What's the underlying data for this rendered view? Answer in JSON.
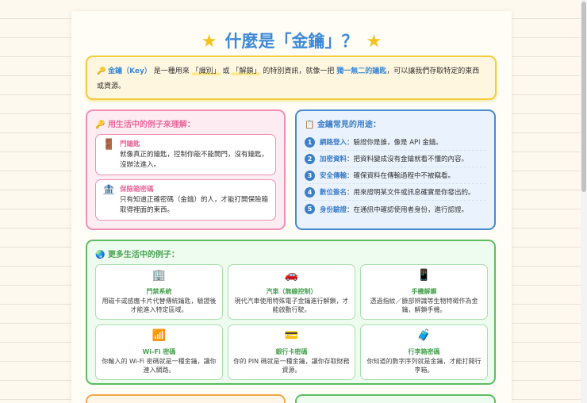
{
  "title": "什麼是「金鑰」？",
  "definition": {
    "term": "金鑰（Key）",
    "p1": "是一種用來",
    "hl1": "「識別」",
    "p2": "或",
    "hl2": "「解鎖」",
    "p3": "的特別資訊，就像一把",
    "em": "獨一無二的鑰匙",
    "p4": "，可以讓我們存取特定的東西或資源。"
  },
  "examples": {
    "heading": "用生活中的例子來理解：",
    "items": [
      {
        "icon": "door-icon",
        "glyph": "🚪",
        "title": "門鑰匙",
        "text": "就像真正的鑰匙，控制你能不能開門，沒有鑰匙，沒辦法進入。"
      },
      {
        "icon": "bank-icon",
        "glyph": "🏦",
        "title": "保險箱密碼",
        "text": "只有知道正確密碼（金鑰）的人，才能打開保險箱取得裡面的東西。"
      }
    ]
  },
  "uses": {
    "heading": "金鑰常見的用途：",
    "items": [
      {
        "n": "1",
        "k": "網路登入",
        "v": "：驗證你是誰，像是 API 金鑰。"
      },
      {
        "n": "2",
        "k": "加密資料",
        "v": "：把資料變成沒有金鑰就看不懂的內容。"
      },
      {
        "n": "3",
        "k": "安全傳輸",
        "v": "：確保資料在傳輸過程中不被竊看。"
      },
      {
        "n": "4",
        "k": "數位簽名",
        "v": "：用來證明某文件或訊息確實是你發出的。"
      },
      {
        "n": "5",
        "k": "身份驗證",
        "v": "：在通訊中確認使用者身份，進行認證。"
      }
    ]
  },
  "more": {
    "heading": "更多生活中的例子：",
    "items": [
      {
        "icon": "building-icon",
        "glyph": "🏢",
        "title": "門禁系統",
        "text": "用磁卡或感應卡片代替傳統鑰匙，驗證後才能進入特定區域。"
      },
      {
        "icon": "car-icon",
        "glyph": "🚗",
        "title": "汽車（無線控制）",
        "text": "現代汽車使用特殊電子金鑰進行解鎖，才能啟動行駛。"
      },
      {
        "icon": "phone-icon",
        "glyph": "📱",
        "title": "手機解鎖",
        "text": "透過指紋／臉部辨識等生物特徵作為金鑰，解鎖手機。"
      },
      {
        "icon": "wifi-signal-icon",
        "glyph": "📶",
        "title": "Wi-Fi 密碼",
        "text": "你輸入的 Wi-Fi 密碼就是一種金鑰，讓你連入網路。"
      },
      {
        "icon": "credit-card-icon",
        "glyph": "💳",
        "title": "銀行卡密碼",
        "text": "你的 PIN 碼就是一種金鑰，讓你存取財務資源。"
      },
      {
        "icon": "luggage-icon",
        "glyph": "🧳",
        "title": "行李箱密碼",
        "text": "你知道的數字序列就是金鑰，才能打開行李箱。"
      }
    ]
  }
}
